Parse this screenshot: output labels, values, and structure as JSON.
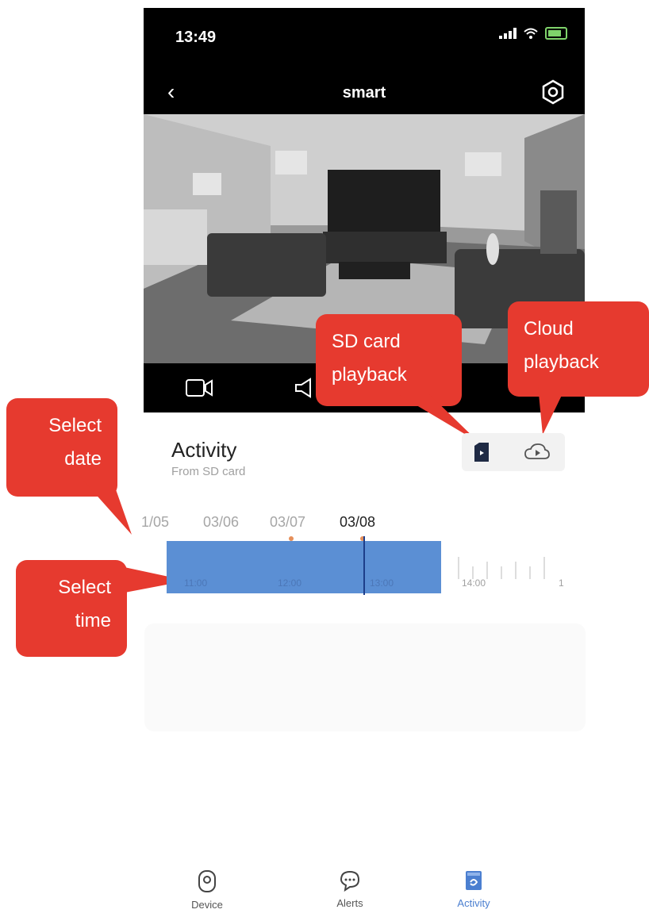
{
  "status_bar": {
    "time": "13:49"
  },
  "nav": {
    "title": "smart"
  },
  "callouts": {
    "sd": "SD card playback",
    "cloud": "Cloud playback",
    "date": "Select date",
    "time": "Select time"
  },
  "activity": {
    "title": "Activity",
    "subtitle": "From SD card"
  },
  "dates": [
    "1/05",
    "03/06",
    "03/07",
    "03/08"
  ],
  "selected_date": "03/08",
  "timeline": {
    "labels": [
      "11:00",
      "12:00",
      "13:00",
      "14:00",
      "1"
    ]
  },
  "tabbar": {
    "items": [
      {
        "label": "Device",
        "icon": "camera-icon"
      },
      {
        "label": "Alerts",
        "icon": "chat-icon"
      },
      {
        "label": "Activity",
        "icon": "activity-icon"
      }
    ],
    "active": "Activity"
  },
  "colors": {
    "callout": "#e63a2f",
    "timeline_recorded": "#5b8fd4",
    "active_tab": "#4b7fd0"
  }
}
